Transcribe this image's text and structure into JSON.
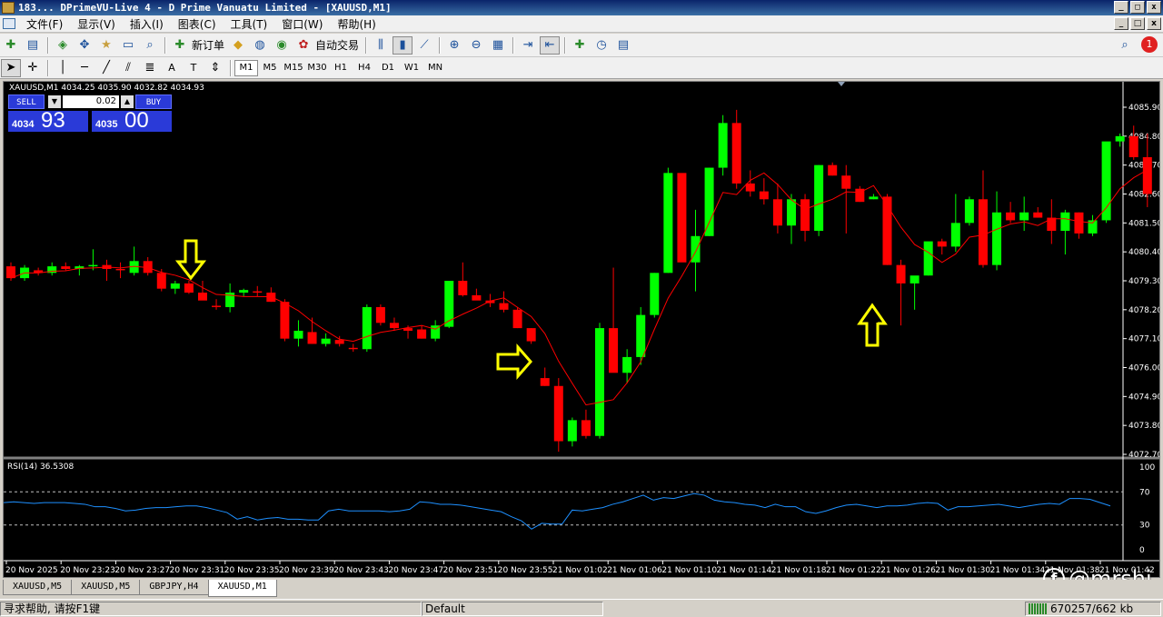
{
  "window": {
    "title": "183... DPrimeVU-Live 4 - D Prime Vanuatu Limited - [XAUUSD,M1]",
    "buttons": [
      "_",
      "□",
      "x"
    ]
  },
  "menu": {
    "items": [
      "文件(F)",
      "显示(V)",
      "插入(I)",
      "图表(C)",
      "工具(T)",
      "窗口(W)",
      "帮助(H)"
    ]
  },
  "toolbar": {
    "new_order": "新订单",
    "auto_trade": "自动交易",
    "notification_count": "1"
  },
  "timeframes": [
    "M1",
    "M5",
    "M15",
    "M30",
    "H1",
    "H4",
    "D1",
    "W1",
    "MN"
  ],
  "active_timeframe": "M1",
  "chart": {
    "symbol_info": "XAUUSD,M1  4034.25 4035.90 4032.82 4034.93",
    "sell_label": "SELL",
    "buy_label": "BUY",
    "lot": "0.02",
    "bid_prefix": "4034",
    "bid_big": "93",
    "ask_prefix": "4035",
    "ask_big": "00",
    "rsi_label": "RSI(14) 36.5308"
  },
  "chart_data": {
    "type": "candlestick",
    "symbol": "XAUUSD",
    "timeframe": "M1",
    "price_axis_labels": [
      4085.9,
      4084.8,
      4083.7,
      4082.6,
      4081.5,
      4080.4,
      4079.3,
      4078.2,
      4077.1,
      4076.0,
      4074.9,
      4073.8,
      4072.7
    ],
    "ylim": [
      4072.55,
      4086.25
    ],
    "time_axis_labels": [
      "20 Nov 2025",
      "20 Nov 23:23",
      "20 Nov 23:27",
      "20 Nov 23:31",
      "20 Nov 23:35",
      "20 Nov 23:39",
      "20 Nov 23:43",
      "20 Nov 23:47",
      "20 Nov 23:51",
      "20 Nov 23:55",
      "21 Nov 01:02",
      "21 Nov 01:06",
      "21 Nov 01:10",
      "21 Nov 01:14",
      "21 Nov 01:18",
      "21 Nov 01:22",
      "21 Nov 01:26",
      "21 Nov 01:30",
      "21 Nov 01:34",
      "21 Nov 01:38",
      "21 Nov 01:42"
    ],
    "candles": [
      [
        4079.85,
        4080.0,
        4079.3,
        4079.4
      ],
      [
        4079.4,
        4079.9,
        4079.3,
        4079.8
      ],
      [
        4079.7,
        4079.8,
        4079.5,
        4079.6
      ],
      [
        4079.6,
        4080.0,
        4079.5,
        4079.85
      ],
      [
        4079.85,
        4080.0,
        4079.7,
        4079.75
      ],
      [
        4079.75,
        4079.9,
        4079.5,
        4079.85
      ],
      [
        4079.85,
        4080.5,
        4079.7,
        4079.9
      ],
      [
        4079.9,
        4080.1,
        4079.3,
        4079.75
      ],
      [
        4079.75,
        4080.0,
        4079.4,
        4079.7
      ],
      [
        4079.6,
        4080.6,
        4079.5,
        4080.05
      ],
      [
        4080.05,
        4080.2,
        4079.5,
        4079.6
      ],
      [
        4079.6,
        4079.75,
        4078.9,
        4079.0
      ],
      [
        4079.0,
        4079.3,
        4078.8,
        4079.2
      ],
      [
        4079.2,
        4079.3,
        4078.8,
        4078.85
      ],
      [
        4078.85,
        4079.3,
        4078.6,
        4078.55
      ],
      [
        4078.35,
        4078.6,
        4078.2,
        4078.3
      ],
      [
        4078.3,
        4079.2,
        4078.1,
        4078.85
      ],
      [
        4078.85,
        4079.0,
        4078.7,
        4078.95
      ],
      [
        4078.9,
        4079.1,
        4078.7,
        4078.85
      ],
      [
        4078.85,
        4079.05,
        4078.5,
        4078.5
      ],
      [
        4078.5,
        4078.6,
        4077.0,
        4077.1
      ],
      [
        4077.1,
        4077.8,
        4076.8,
        4077.4
      ],
      [
        4077.35,
        4077.9,
        4076.9,
        4076.9
      ],
      [
        4076.9,
        4077.3,
        4076.8,
        4077.1
      ],
      [
        4077.05,
        4077.2,
        4076.8,
        4076.9
      ],
      [
        4076.75,
        4076.9,
        4076.6,
        4076.7
      ],
      [
        4076.7,
        4078.4,
        4076.6,
        4078.3
      ],
      [
        4078.3,
        4078.4,
        4077.6,
        4077.7
      ],
      [
        4077.7,
        4077.9,
        4077.4,
        4077.5
      ],
      [
        4077.5,
        4077.6,
        4077.1,
        4077.4
      ],
      [
        4077.45,
        4077.6,
        4077.1,
        4077.1
      ],
      [
        4077.1,
        4077.8,
        4077.0,
        4077.6
      ],
      [
        4077.55,
        4079.3,
        4077.5,
        4079.3
      ],
      [
        4079.3,
        4080.0,
        4078.7,
        4078.75
      ],
      [
        4078.75,
        4079.0,
        4078.6,
        4078.55
      ],
      [
        4078.55,
        4078.8,
        4078.3,
        4078.45
      ],
      [
        4078.45,
        4078.9,
        4078.1,
        4078.2
      ],
      [
        4078.2,
        4078.3,
        4077.5,
        4077.5
      ],
      [
        4077.5,
        4077.5,
        4076.9,
        4077.0
      ],
      [
        4075.6,
        4076.0,
        4075.3,
        4075.3
      ],
      [
        4075.3,
        4075.6,
        4072.8,
        4073.2
      ],
      [
        4073.2,
        4074.1,
        4073.0,
        4074.0
      ],
      [
        4074.0,
        4074.4,
        4073.3,
        4073.4
      ],
      [
        4073.4,
        4077.7,
        4073.3,
        4077.5
      ],
      [
        4077.5,
        4079.8,
        4075.9,
        4075.8
      ],
      [
        4075.8,
        4076.7,
        4075.4,
        4076.4
      ],
      [
        4076.4,
        4078.3,
        4076.1,
        4078.0
      ],
      [
        4078.0,
        4079.6,
        4077.9,
        4079.6
      ],
      [
        4079.6,
        4083.6,
        4079.6,
        4083.4
      ],
      [
        4083.4,
        4083.2,
        4080.2,
        4080.0
      ],
      [
        4080.0,
        4082.0,
        4078.9,
        4081.0
      ],
      [
        4081.0,
        4083.6,
        4081.0,
        4083.6
      ],
      [
        4083.6,
        4085.6,
        4083.3,
        4085.3
      ],
      [
        4085.3,
        4085.8,
        4082.8,
        4083.0
      ],
      [
        4083.0,
        4083.5,
        4082.5,
        4082.7
      ],
      [
        4082.7,
        4083.2,
        4082.2,
        4082.4
      ],
      [
        4082.4,
        4083.0,
        4081.1,
        4081.4
      ],
      [
        4081.4,
        4082.6,
        4080.7,
        4082.4
      ],
      [
        4082.4,
        4082.6,
        4080.8,
        4081.2
      ],
      [
        4081.2,
        4083.7,
        4081.0,
        4083.7
      ],
      [
        4083.7,
        4083.8,
        4083.3,
        4083.3
      ],
      [
        4083.3,
        4083.7,
        4081.1,
        4082.8
      ],
      [
        4082.8,
        4082.9,
        4082.3,
        4082.3
      ],
      [
        4082.4,
        4082.6,
        4082.4,
        4082.5
      ],
      [
        4082.5,
        4082.6,
        4079.9,
        4079.9
      ],
      [
        4079.9,
        4080.1,
        4077.6,
        4079.2
      ],
      [
        4079.2,
        4079.4,
        4078.2,
        4079.5
      ],
      [
        4079.5,
        4080.2,
        4079.5,
        4080.8
      ],
      [
        4080.8,
        4080.9,
        4080.3,
        4080.6
      ],
      [
        4080.6,
        4082.6,
        4080.4,
        4081.5
      ],
      [
        4081.5,
        4082.5,
        4081.4,
        4082.4
      ],
      [
        4082.4,
        4083.5,
        4079.8,
        4079.9
      ],
      [
        4079.9,
        4082.7,
        4079.7,
        4081.9
      ],
      [
        4081.9,
        4082.3,
        4081.5,
        4081.6
      ],
      [
        4081.6,
        4082.5,
        4081.2,
        4081.9
      ],
      [
        4081.9,
        4082.1,
        4081.7,
        4081.7
      ],
      [
        4081.7,
        4082.4,
        4080.7,
        4081.2
      ],
      [
        4081.2,
        4082.0,
        4080.3,
        4081.9
      ],
      [
        4081.9,
        4081.9,
        4080.9,
        4081.1
      ],
      [
        4081.1,
        4081.8,
        4081.0,
        4081.6
      ],
      [
        4081.6,
        4084.3,
        4081.5,
        4084.6
      ],
      [
        4084.6,
        4084.9,
        4084.4,
        4084.8
      ],
      [
        4084.8,
        4085.2,
        4083.9,
        4084.0
      ],
      [
        4084.0,
        4084.9,
        4082.1,
        4082.6
      ]
    ],
    "ma_color": "#ff0000",
    "bull_color": "#00ff00",
    "bear_color": "#ff0000",
    "rsi": {
      "levels": [
        100,
        70,
        30,
        0
      ],
      "dashed_levels": [
        70,
        30
      ],
      "value": 36.5308,
      "color": "#1e90ff",
      "values": [
        57,
        58,
        57,
        56,
        57,
        57,
        57,
        56,
        55,
        52,
        52,
        50,
        47,
        48,
        50,
        51,
        51,
        52,
        53,
        53,
        51,
        48,
        45,
        37,
        40,
        36,
        38,
        39,
        37,
        37,
        36,
        36,
        47,
        49,
        47,
        47,
        47,
        47,
        46,
        47,
        49,
        58,
        57,
        55,
        55,
        54,
        52,
        50,
        48,
        46,
        40,
        35,
        25,
        32,
        31,
        31,
        48,
        47,
        49,
        51,
        55,
        58,
        62,
        66,
        60,
        63,
        62,
        65,
        68,
        66,
        60,
        58,
        57,
        55,
        54,
        51,
        55,
        52,
        52,
        46,
        44,
        47,
        51,
        54,
        55,
        53,
        51,
        53,
        53,
        54,
        56,
        57,
        56,
        48,
        52,
        52,
        53,
        54,
        55,
        53,
        51,
        53,
        55,
        56,
        55,
        62,
        62,
        61,
        57,
        53
      ]
    },
    "annotations": [
      {
        "type": "arrow",
        "direction": "down",
        "color": "#ffff00"
      },
      {
        "type": "arrow",
        "direction": "right",
        "color": "#ffff00"
      },
      {
        "type": "arrow",
        "direction": "up",
        "color": "#ffff00"
      }
    ]
  },
  "tabs": [
    "XAUUSD,M5",
    "XAUUSD,M5",
    "GBPJPY,H4",
    "XAUUSD,M1"
  ],
  "active_tab": "XAUUSD,M1",
  "status": {
    "help": "寻求帮助, 请按F1键",
    "profile": "Default",
    "traffic": "670257/662 kb"
  },
  "watermark": "@mrshi"
}
